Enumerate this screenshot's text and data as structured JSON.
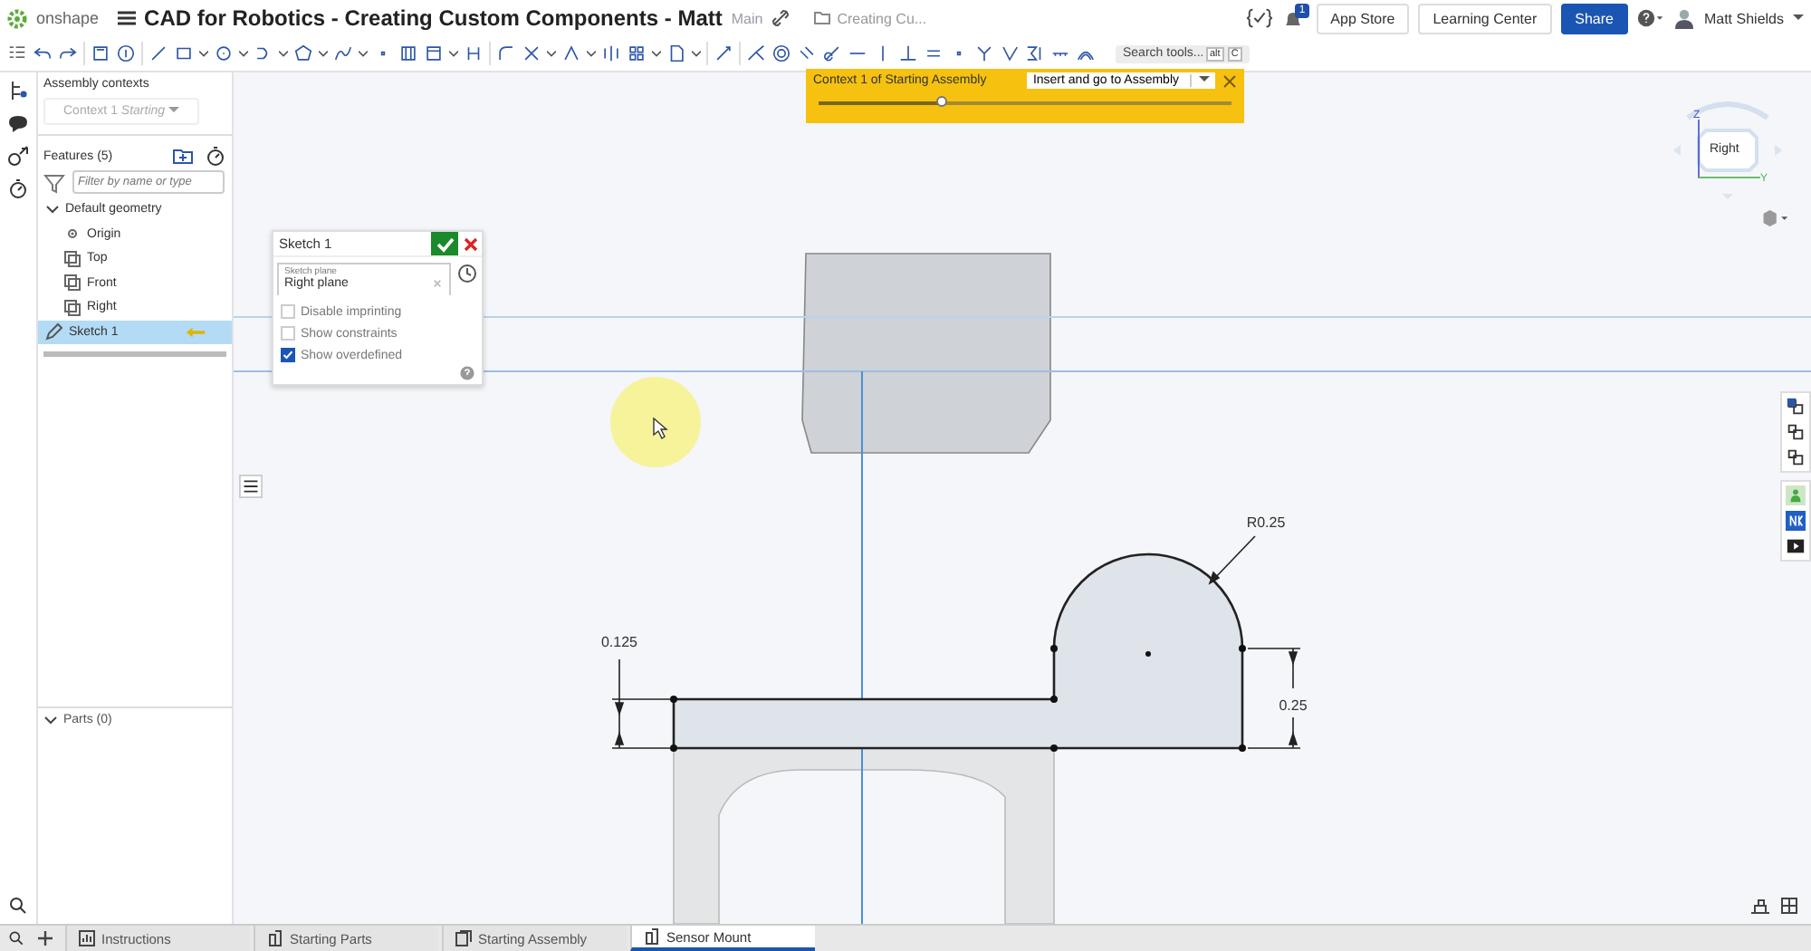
{
  "header": {
    "logo": "onshape",
    "title": "CAD for Robotics - Creating Custom Components - Matt",
    "branch": "Main",
    "folder": "Creating Cu...",
    "notification_count": "1",
    "buttons": [
      "App Store",
      "Learning Center",
      "Share"
    ],
    "user": "Matt Shields"
  },
  "toolbar": {
    "search": {
      "placeholder": "Search tools...",
      "shortcut_keys": [
        "alt",
        "C"
      ]
    }
  },
  "left_panel": {
    "assembly_contexts": {
      "title": "Assembly contexts",
      "context": "Context 1",
      "context_status": "Starting"
    },
    "features": {
      "title": "Features (5)",
      "filter": {
        "placeholder": "Filter by name or type"
      },
      "tree": [
        {
          "label": "Default geometry",
          "kind": "group",
          "expanded": true,
          "selected": false,
          "children": [
            {
              "label": "Origin",
              "kind": "origin",
              "selected": false
            },
            {
              "label": "Top",
              "kind": "plane",
              "selected": false
            },
            {
              "label": "Front",
              "kind": "plane",
              "selected": false
            },
            {
              "label": "Right",
              "kind": "plane",
              "selected": false
            }
          ]
        },
        {
          "label": "Sketch 1",
          "kind": "sketch",
          "selected": true
        }
      ]
    },
    "parts": {
      "title": "Parts (0)"
    }
  },
  "context_bar": {
    "title": "Context 1 of Starting Assembly",
    "action": "Insert and go to Assembly",
    "level": 0.3
  },
  "sketch_dialog": {
    "title": "Sketch 1",
    "plane_label": "Sketch plane",
    "plane": "Right plane",
    "options": [
      {
        "label": "Disable imprinting",
        "checked": false
      },
      {
        "label": "Show constraints",
        "checked": false
      },
      {
        "label": "Show overdefined",
        "checked": true
      }
    ]
  },
  "view_cube": {
    "face": "Right",
    "axes": [
      "Z",
      "Y"
    ]
  },
  "sketch": {
    "radius_label": "R0.25",
    "thickness_label": "0.125",
    "height_label": "0.25"
  },
  "tabs": [
    {
      "label": "Instructions",
      "kind": "document",
      "selected": false
    },
    {
      "label": "Starting Parts",
      "kind": "part",
      "selected": false
    },
    {
      "label": "Starting Assembly",
      "kind": "assembly",
      "selected": false
    },
    {
      "label": "Sensor Mount",
      "kind": "part",
      "selected": true
    }
  ]
}
